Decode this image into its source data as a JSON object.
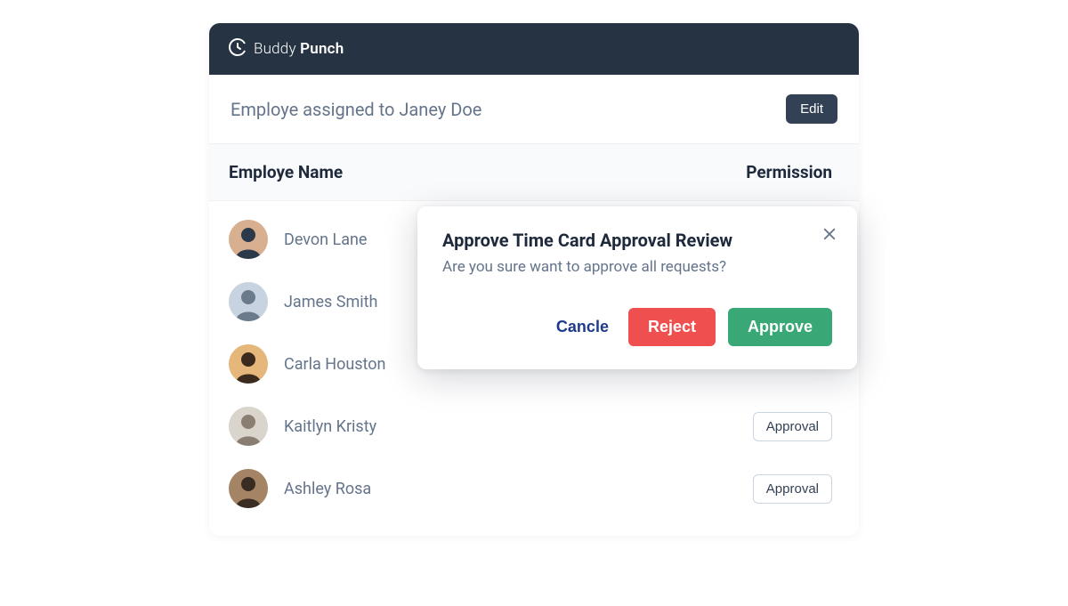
{
  "brand": {
    "name_light": "Buddy",
    "name_bold": "Punch"
  },
  "page": {
    "title": "Employe assigned to Janey Doe",
    "edit_label": "Edit"
  },
  "table": {
    "col_name": "Employe Name",
    "col_permission": "Permission",
    "approval_label": "Approval",
    "rows": [
      {
        "name": "Devon Lane",
        "avatar_bg": "#d8b090",
        "avatar_fg": "#2b3a4a"
      },
      {
        "name": "James Smith",
        "avatar_bg": "#c7d3e0",
        "avatar_fg": "#6b7b8c"
      },
      {
        "name": "Carla Houston",
        "avatar_bg": "#e5b77a",
        "avatar_fg": "#3b2b1f"
      },
      {
        "name": "Kaitlyn Kristy",
        "avatar_bg": "#d9d4cc",
        "avatar_fg": "#8a7e72"
      },
      {
        "name": "Ashley Rosa",
        "avatar_bg": "#a58466",
        "avatar_fg": "#3a2c22"
      }
    ]
  },
  "dialog": {
    "title": "Approve Time Card Approval Review",
    "body": "Are you sure want to approve all requests?",
    "cancel": "Cancle",
    "reject": "Reject",
    "approve": "Approve"
  }
}
